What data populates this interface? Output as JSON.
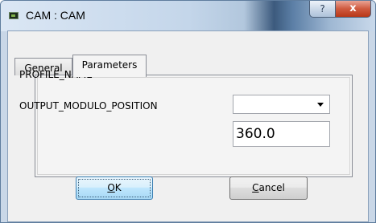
{
  "window": {
    "title": "CAM : CAM",
    "help_glyph": "?",
    "close_glyph": "x"
  },
  "tabs": [
    {
      "label": "General",
      "selected": false
    },
    {
      "label": "Parameters",
      "selected": true
    }
  ],
  "parameters": {
    "profile_name_label": "PROFILE_NAME",
    "profile_name_value": "",
    "output_modulo_label": "OUTPUT_MODULO_POSITION",
    "output_modulo_value": "360.0"
  },
  "buttons": {
    "ok_mnemonic": "O",
    "ok_rest": "K",
    "cancel_mnemonic": "C",
    "cancel_rest": "ancel"
  },
  "icons": [
    "app-icon",
    "help-icon",
    "close-icon",
    "dropdown-arrow-icon"
  ],
  "colors": {
    "titlebar_accent": "#3c5a7d",
    "close_button": "#c9462a",
    "ok_button_border": "#3c7fb1"
  }
}
